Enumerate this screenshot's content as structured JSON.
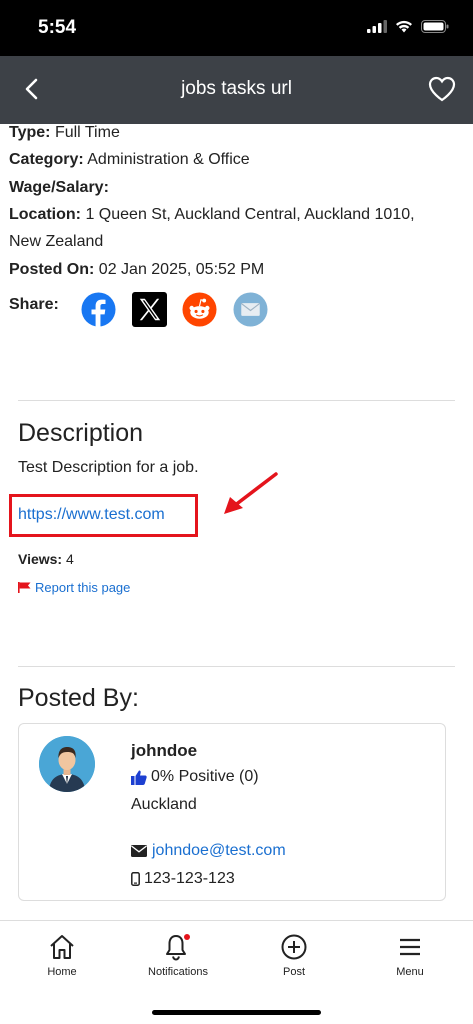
{
  "status_bar": {
    "time": "5:54"
  },
  "nav": {
    "title": "jobs tasks url"
  },
  "details": {
    "type_label": "Type:",
    "type_value": "Full Time",
    "category_label": "Category:",
    "category_value": "Administration & Office",
    "wage_label": "Wage/Salary:",
    "wage_value": "",
    "location_label": "Location:",
    "location_value_line1": "1 Queen St, Auckland Central, Auckland 1010,",
    "location_value_line2": "New Zealand",
    "posted_label": "Posted On:",
    "posted_value": "02 Jan 2025, 05:52 PM"
  },
  "share": {
    "label": "Share:",
    "icons": [
      "facebook-icon",
      "x-icon",
      "reddit-icon",
      "email-icon"
    ]
  },
  "description": {
    "title": "Description",
    "text": "Test Description for a job.",
    "link": "https://www.test.com",
    "views_label": "Views:",
    "views_value": "4",
    "report_label": "Report this page"
  },
  "posted_by": {
    "title": "Posted By:",
    "username": "johndoe",
    "rating": "0% Positive (0)",
    "city": "Auckland",
    "email": "johndoe@test.com",
    "phone": "123-123-123"
  },
  "tabs": [
    {
      "label": "Home",
      "icon": "home-icon"
    },
    {
      "label": "Notifications",
      "icon": "bell-icon"
    },
    {
      "label": "Post",
      "icon": "plus-circle-icon"
    },
    {
      "label": "Menu",
      "icon": "menu-icon"
    }
  ],
  "colors": {
    "nav_bg": "#3d4147",
    "link": "#1a6fd0",
    "highlight": "#e4141c"
  }
}
